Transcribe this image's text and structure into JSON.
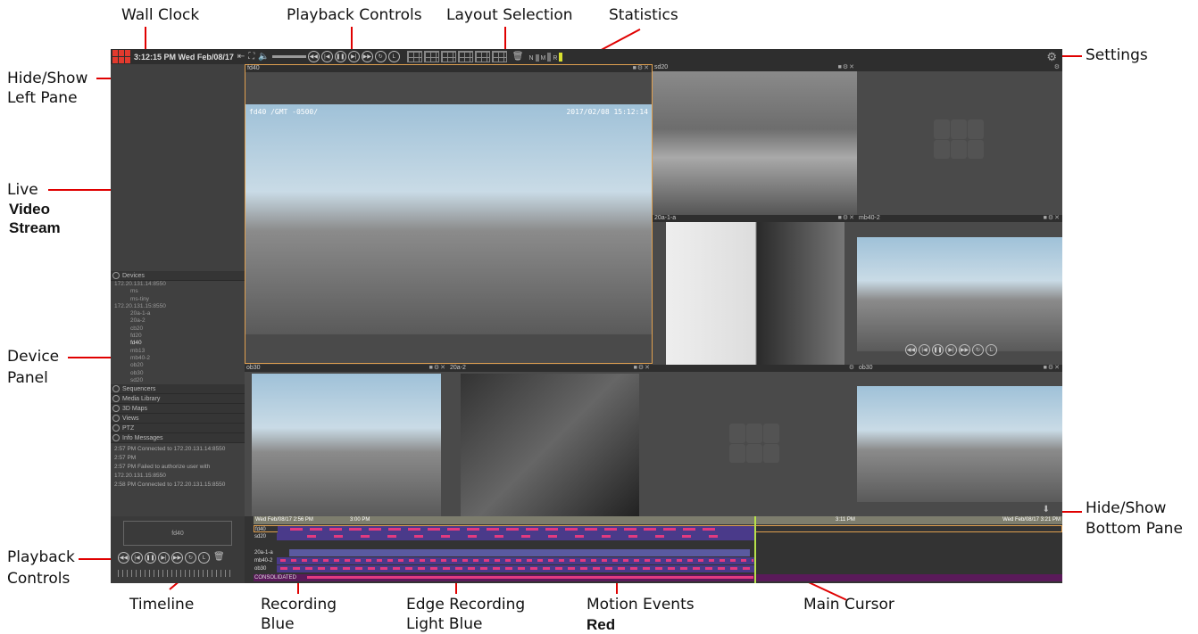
{
  "callouts": {
    "wall_clock": "Wall Clock",
    "playback_controls_top": "Playback Controls",
    "layout_selection": "Layout Selection",
    "statistics": "Statistics",
    "settings": "Settings",
    "hide_show": "Hide/Show",
    "left_pane": "Left Pane",
    "live": "Live",
    "video": "Video",
    "stream": "Stream",
    "device": "Device",
    "panel": "Panel",
    "hide_show_b": "Hide/Show",
    "bottom_pane": "Bottom Pane",
    "playback": "Playback",
    "controls": "Controls",
    "timeline": "Timeline",
    "recording": "Recording",
    "blue": "Blue",
    "edge_recording": "Edge Recording",
    "light_blue": "Light Blue",
    "motion_events": "Motion Events",
    "red": "Red",
    "main_cursor": "Main Cursor"
  },
  "toolbar": {
    "clock": "3:12:15 PM Wed Feb/08/17",
    "stats_labels": [
      "N",
      "M",
      "R"
    ]
  },
  "devices": {
    "header": "Devices",
    "items": [
      "172.20.131.14:8550",
      "ms",
      "ms-tiny",
      "172.20.131.15:8550",
      "20a-1-a",
      "20a-2",
      "cb20",
      "fd20",
      "fd40",
      "mb13",
      "mb40-2",
      "ob20",
      "ob30",
      "sd20"
    ]
  },
  "panels": [
    "Sequencers",
    "Media Library",
    "3D Maps",
    "Views",
    "PTZ",
    "Info Messages"
  ],
  "messages": [
    "2:57 PM  Connected to 172.20.131.14:8550",
    "2:57 PM",
    "2:57 PM  Failed to authorize user with",
    "172.20.131.15:8550",
    "2:58 PM  Connected to 172.20.131.15:8550"
  ],
  "tiles": {
    "fd40": "fd40",
    "sd20": "sd20",
    "t20a1a": "20a-1-a",
    "mb402": "mb40-2",
    "ob30": "ob30",
    "t20a2": "20a-2",
    "ob30b": "ob30"
  },
  "osd": {
    "fd40_left": "fd40 /GMT -0500/",
    "fd40_right": "2017/02/08 15:12:14"
  },
  "bottom": {
    "camera": "fd40",
    "timeline_start": "Wed Feb/08/17 2:56 PM",
    "t_300": "3:00 PM",
    "t_311": "3:11 PM",
    "timeline_end": "Wed Feb/08/17 3:21 PM",
    "tracks": [
      "fd40",
      "sd20",
      "20a-1-a",
      "mb40-2",
      "ob30",
      "CONSOLIDATED"
    ]
  }
}
